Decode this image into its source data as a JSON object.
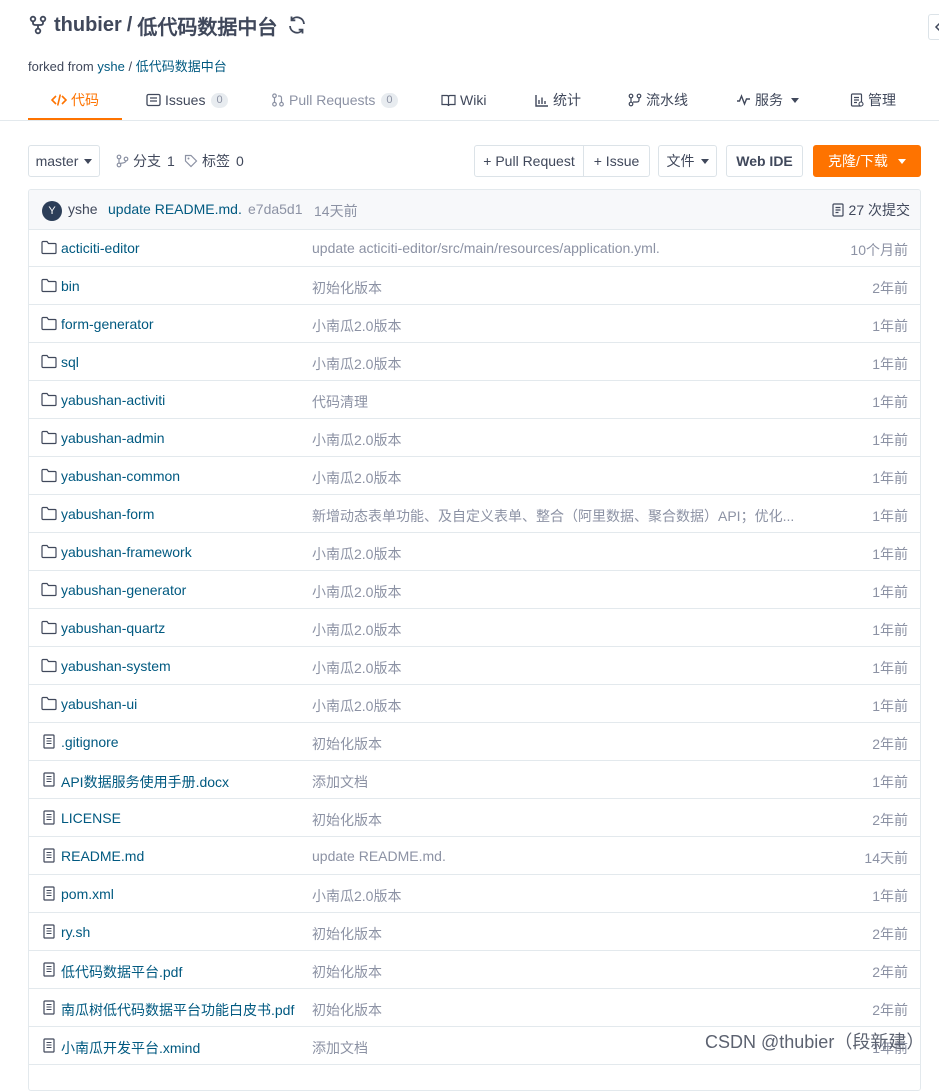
{
  "repo": {
    "owner": "thubier",
    "separator": "/",
    "name": "低代码数据中台",
    "forked_prefix": "forked from",
    "forked_owner": "yshe",
    "forked_separator": "/",
    "forked_name": "低代码数据中台"
  },
  "tabs": [
    {
      "label": "代码",
      "icon": "code-icon",
      "active": true
    },
    {
      "label": "Issues",
      "icon": "issues-icon",
      "count": "0"
    },
    {
      "label": "Pull Requests",
      "icon": "pull-request-icon",
      "count": "0"
    },
    {
      "label": "Wiki",
      "icon": "wiki-icon"
    },
    {
      "label": "统计",
      "icon": "stats-icon"
    },
    {
      "label": "流水线",
      "icon": "pipeline-icon"
    },
    {
      "label": "服务",
      "icon": "service-icon"
    },
    {
      "label": "管理",
      "icon": "admin-icon"
    }
  ],
  "toolbar": {
    "branch": "master",
    "branches_label": "分支",
    "branches_count": "1",
    "tags_label": "标签",
    "tags_count": "0",
    "pull_request_btn": "+ Pull Request",
    "issue_btn": "+ Issue",
    "file_btn": "文件",
    "webide_btn": "Web IDE",
    "clone_btn": "克隆/下载"
  },
  "commit": {
    "avatar_letter": "Y",
    "author": "yshe",
    "message": "update README.md.",
    "sha": "e7da5d1",
    "time": "14天前",
    "total": "27 次提交"
  },
  "files": [
    {
      "type": "folder",
      "name": "acticiti-editor",
      "message": "update acticiti-editor/src/main/resources/application.yml.",
      "time": "10个月前"
    },
    {
      "type": "folder",
      "name": "bin",
      "message": "初始化版本",
      "time": "2年前"
    },
    {
      "type": "folder",
      "name": "form-generator",
      "message": "小南瓜2.0版本",
      "time": "1年前"
    },
    {
      "type": "folder",
      "name": "sql",
      "message": "小南瓜2.0版本",
      "time": "1年前"
    },
    {
      "type": "folder",
      "name": "yabushan-activiti",
      "message": "代码清理",
      "time": "1年前"
    },
    {
      "type": "folder",
      "name": "yabushan-admin",
      "message": "小南瓜2.0版本",
      "time": "1年前"
    },
    {
      "type": "folder",
      "name": "yabushan-common",
      "message": "小南瓜2.0版本",
      "time": "1年前"
    },
    {
      "type": "folder",
      "name": "yabushan-form",
      "message": "新增动态表单功能、及自定义表单、整合（阿里数据、聚合数据）API；优化...",
      "time": "1年前"
    },
    {
      "type": "folder",
      "name": "yabushan-framework",
      "message": "小南瓜2.0版本",
      "time": "1年前"
    },
    {
      "type": "folder",
      "name": "yabushan-generator",
      "message": "小南瓜2.0版本",
      "time": "1年前"
    },
    {
      "type": "folder",
      "name": "yabushan-quartz",
      "message": "小南瓜2.0版本",
      "time": "1年前"
    },
    {
      "type": "folder",
      "name": "yabushan-system",
      "message": "小南瓜2.0版本",
      "time": "1年前"
    },
    {
      "type": "folder",
      "name": "yabushan-ui",
      "message": "小南瓜2.0版本",
      "time": "1年前"
    },
    {
      "type": "file",
      "name": ".gitignore",
      "message": "初始化版本",
      "time": "2年前"
    },
    {
      "type": "file",
      "name": "API数据服务使用手册.docx",
      "message": "添加文档",
      "time": "1年前"
    },
    {
      "type": "file",
      "name": "LICENSE",
      "message": "初始化版本",
      "time": "2年前"
    },
    {
      "type": "file",
      "name": "README.md",
      "message": "update README.md.",
      "time": "14天前"
    },
    {
      "type": "file",
      "name": "pom.xml",
      "message": "小南瓜2.0版本",
      "time": "1年前"
    },
    {
      "type": "file",
      "name": "ry.sh",
      "message": "初始化版本",
      "time": "2年前"
    },
    {
      "type": "file",
      "name": "低代码数据平台.pdf",
      "message": "初始化版本",
      "time": "2年前"
    },
    {
      "type": "file",
      "name": "南瓜树低代码数据平台功能白皮书.pdf",
      "message": "初始化版本",
      "time": "2年前"
    },
    {
      "type": "file",
      "name": "小南瓜开发平台.xmind",
      "message": "添加文档",
      "time": "1年前"
    }
  ],
  "watermark": "CSDN @thubier（段新建）",
  "colors": {
    "accent": "#fe7300",
    "link": "#005980",
    "muted": "#8c92a4",
    "text": "#40485b"
  }
}
